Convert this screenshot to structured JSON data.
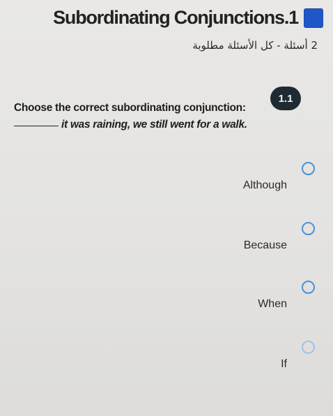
{
  "header": {
    "title": "Subordinating Conjunctions.1",
    "subtitle": "2 أسئلة - كل الأسئلة مطلوبة"
  },
  "question": {
    "number": "1.1",
    "prompt": "Choose the correct subordinating conjunction:",
    "sentence": "it was raining, we still went for a walk."
  },
  "options": [
    {
      "label": "Although"
    },
    {
      "label": "Because"
    },
    {
      "label": "When"
    },
    {
      "label": "If"
    }
  ],
  "colors": {
    "flag": "#1f57c9",
    "radio": "#4a90d9",
    "badge": "#1f2a33"
  },
  "icons": {
    "flag": "flag-square-icon",
    "radio": "radio-unchecked-icon"
  }
}
